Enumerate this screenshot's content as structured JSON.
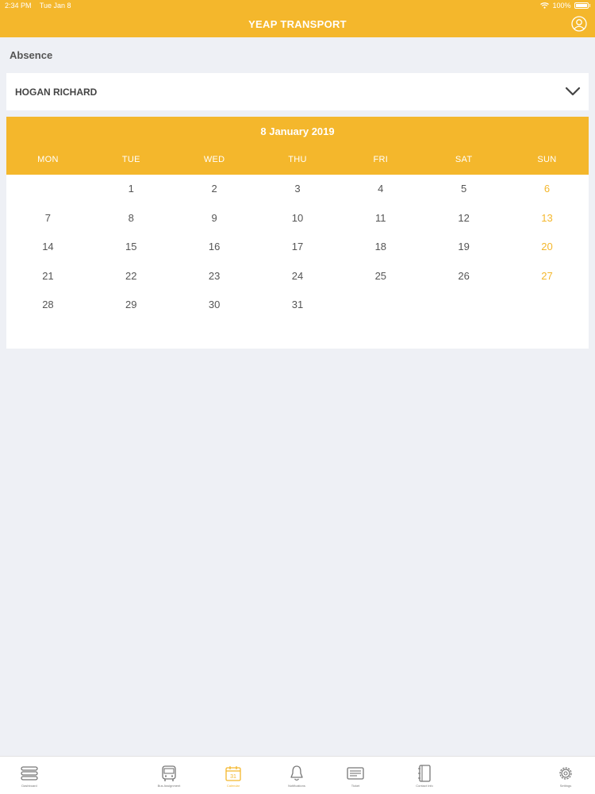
{
  "status_bar": {
    "time": "2:34 PM",
    "date": "Tue Jan 8",
    "battery": "100%"
  },
  "header": {
    "title": "YEAP TRANSPORT",
    "profile_icon": "user-circle-icon"
  },
  "section_title": "Absence",
  "student_select": {
    "value": "HOGAN RICHARD",
    "icon": "chevron-down-icon"
  },
  "calendar": {
    "month_label": "8 January 2019",
    "weekdays": [
      "MON",
      "TUE",
      "WED",
      "THU",
      "FRI",
      "SAT",
      "SUN"
    ],
    "days": [
      "",
      "1",
      "2",
      "3",
      "4",
      "5",
      "6",
      "7",
      "8",
      "9",
      "10",
      "11",
      "12",
      "13",
      "14",
      "15",
      "16",
      "17",
      "18",
      "19",
      "20",
      "21",
      "22",
      "23",
      "24",
      "25",
      "26",
      "27",
      "28",
      "29",
      "30",
      "31",
      "",
      "",
      ""
    ]
  },
  "tabs": [
    {
      "label": "Dashboard",
      "icon": "menu-icon"
    },
    {
      "label": "Bus Assignment",
      "icon": "bus-icon"
    },
    {
      "label": "Calendar",
      "icon": "calendar-icon"
    },
    {
      "label": "Notifications",
      "icon": "bell-icon"
    },
    {
      "label": "Ticket",
      "icon": "ticket-icon"
    },
    {
      "label": "Contact Info",
      "icon": "notebook-icon"
    },
    {
      "label": "Settings",
      "icon": "gear-icon"
    }
  ],
  "colors": {
    "accent": "#f4b72c",
    "background": "#eef0f5",
    "text": "#555555"
  }
}
